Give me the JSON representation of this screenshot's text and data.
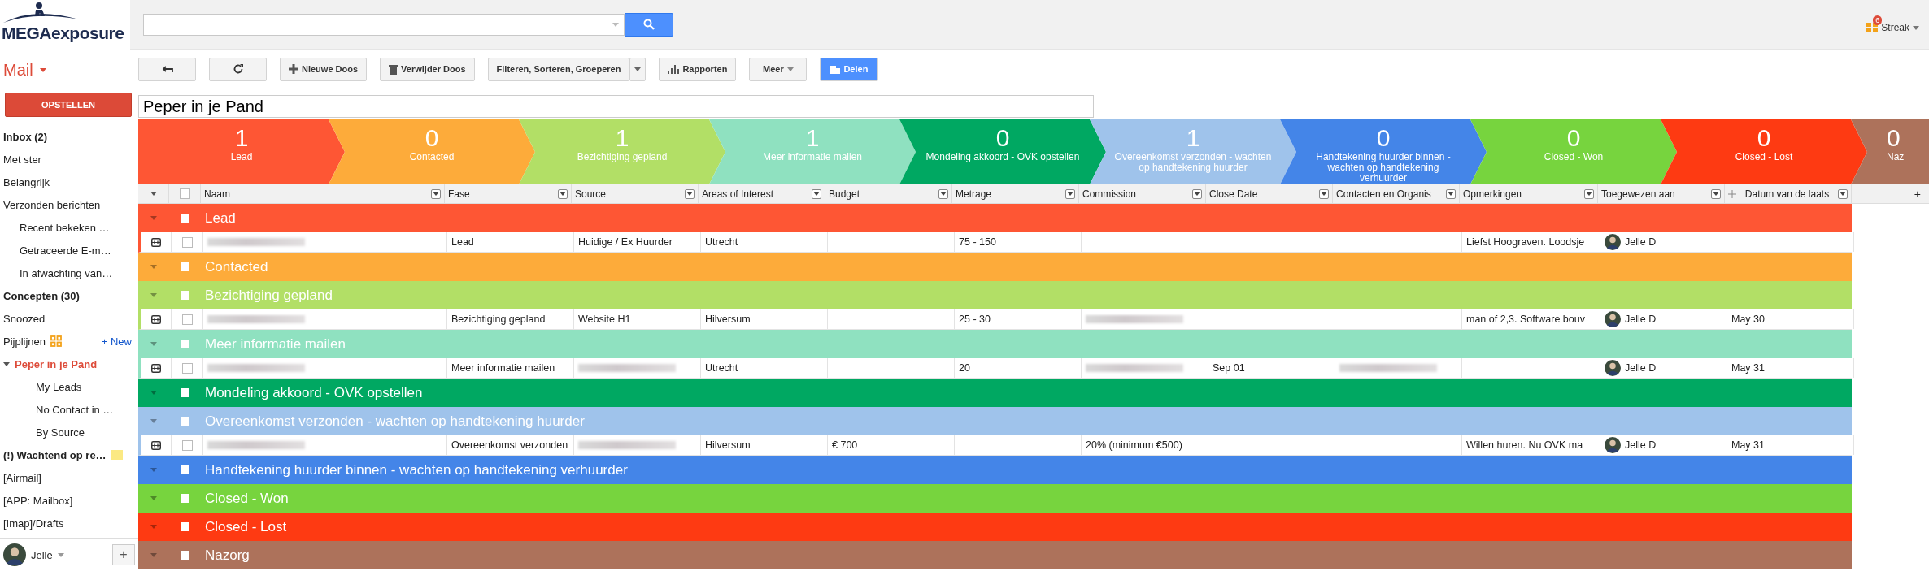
{
  "logo": {
    "text": "MEGAexposure"
  },
  "app_menu": {
    "label": "Mail"
  },
  "compose": {
    "label": "OPSTELLEN"
  },
  "nav": [
    {
      "label": "Inbox (2)",
      "bold": true,
      "selected": false
    },
    {
      "label": "Met ster",
      "bold": false,
      "selected": false
    },
    {
      "label": "Belangrijk",
      "bold": false,
      "selected": false
    },
    {
      "label": "Verzonden berichten",
      "bold": false,
      "selected": false,
      "children": [
        {
          "label": "Recent bekeken …",
          "bold": false,
          "selected": false
        },
        {
          "label": "Getraceerde E-m…",
          "bold": false,
          "selected": false
        },
        {
          "label": "In afwachting van…",
          "bold": false,
          "selected": false
        }
      ]
    },
    {
      "label": "Concepten (30)",
      "bold": true,
      "selected": false
    },
    {
      "label": "Snoozed",
      "bold": false,
      "selected": false
    },
    {
      "label": "Pijplijnen",
      "kind": "pipelines",
      "action": "+ New",
      "bold": false,
      "selected": false
    },
    {
      "label": "Peper in je Pand",
      "bold": true,
      "selected": true,
      "expanded": true,
      "children": [
        {
          "label": "My Leads",
          "bold": false,
          "selected": false
        },
        {
          "label": "No Contact in …",
          "bold": false,
          "selected": false
        },
        {
          "label": "By Source",
          "bold": false,
          "selected": false
        }
      ]
    },
    {
      "label": "(!) Wachtend op re…",
      "bold": true,
      "selected": false,
      "color": "#fbe983"
    },
    {
      "label": "[Airmail]",
      "bold": false,
      "selected": false
    },
    {
      "label": "[APP: Mailbox]",
      "bold": false,
      "selected": false
    },
    {
      "label": "[Imap]/Drafts",
      "bold": false,
      "selected": false
    }
  ],
  "account": {
    "name": "Jelle",
    "add": "+"
  },
  "streak": {
    "label": "Streak",
    "badge": "6"
  },
  "toolbar": [
    {
      "kind": "back"
    },
    {
      "kind": "refresh"
    },
    {
      "kind": "new",
      "label": "Nieuwe Doos"
    },
    {
      "kind": "delete",
      "label": "Verwijder Doos"
    },
    {
      "kind": "filter",
      "label": "Filteren, Sorteren, Groeperen"
    },
    {
      "kind": "reports",
      "label": "Rapporten"
    },
    {
      "kind": "more",
      "label": "Meer"
    },
    {
      "kind": "share",
      "label": "Delen"
    }
  ],
  "pipeline_title": {
    "value": "Peper in je Pand"
  },
  "stages": [
    {
      "count": "1",
      "label": "Lead",
      "color": "#fe5634"
    },
    {
      "count": "0",
      "label": "Contacted",
      "color": "#fdab3a"
    },
    {
      "count": "1",
      "label": "Bezichtiging gepland",
      "color": "#b2df66"
    },
    {
      "count": "1",
      "label": "Meer informatie mailen",
      "color": "#8fe1c0"
    },
    {
      "count": "0",
      "label": "Mondeling akkoord - OVK opstellen",
      "color": "#00a862"
    },
    {
      "count": "1",
      "label": "Overeenkomst verzonden - wachten op handtekening huurder",
      "color": "#9fc3eb"
    },
    {
      "count": "0",
      "label": "Handtekening huurder binnen - wachten op handtekening verhuurder",
      "color": "#4485e8"
    },
    {
      "count": "0",
      "label": "Closed - Won",
      "color": "#77d43e"
    },
    {
      "count": "0",
      "label": "Closed - Lost",
      "color": "#fe3a12"
    },
    {
      "count": "0",
      "label": "Naz",
      "color": "#ad725b"
    }
  ],
  "columns": [
    {
      "label": "Naam"
    },
    {
      "label": "Fase"
    },
    {
      "label": "Source"
    },
    {
      "label": "Areas of Interest"
    },
    {
      "label": "Budget"
    },
    {
      "label": "Metrage"
    },
    {
      "label": "Commission"
    },
    {
      "label": "Close Date"
    },
    {
      "label": "Contacten en Organis"
    },
    {
      "label": "Opmerkingen"
    },
    {
      "label": "Toegewezen aan"
    },
    {
      "label": "Datum van de laats",
      "kind": "magic"
    }
  ],
  "select_all": {
    "checked": false
  },
  "add_column": "+",
  "groups": [
    {
      "label": "Lead",
      "color": "#fe5634",
      "checked": false,
      "rows": [
        {
          "checked": false,
          "cells": [
            {
              "kind": "redacted"
            },
            {
              "kind": "text",
              "text": "Lead"
            },
            {
              "kind": "text",
              "text": "Huidige / Ex Huurder"
            },
            {
              "kind": "text",
              "text": "Utrecht"
            },
            {
              "kind": "empty"
            },
            {
              "kind": "text",
              "text": "75 - 150"
            },
            {
              "kind": "empty"
            },
            {
              "kind": "empty"
            },
            {
              "kind": "empty"
            },
            {
              "kind": "text",
              "text": "Liefst Hoograven. Loodsje"
            },
            {
              "kind": "assignee",
              "text": "Jelle D"
            },
            {
              "kind": "empty"
            }
          ]
        }
      ]
    },
    {
      "label": "Contacted",
      "color": "#fdab3a",
      "checked": false
    },
    {
      "label": "Bezichtiging gepland",
      "color": "#b2df66",
      "checked": false,
      "rows": [
        {
          "checked": false,
          "cells": [
            {
              "kind": "redacted"
            },
            {
              "kind": "text",
              "text": "Bezichtiging gepland"
            },
            {
              "kind": "text",
              "text": "Website H1"
            },
            {
              "kind": "text",
              "text": "Hilversum"
            },
            {
              "kind": "empty"
            },
            {
              "kind": "text",
              "text": "25 - 30"
            },
            {
              "kind": "redacted"
            },
            {
              "kind": "empty"
            },
            {
              "kind": "empty"
            },
            {
              "kind": "text",
              "text": "man of 2,3. Software bouv"
            },
            {
              "kind": "assignee",
              "text": "Jelle D"
            },
            {
              "kind": "text",
              "text": "May 30"
            }
          ]
        }
      ]
    },
    {
      "label": "Meer informatie mailen",
      "color": "#8fe1c0",
      "checked": false,
      "rows": [
        {
          "checked": false,
          "cells": [
            {
              "kind": "redacted"
            },
            {
              "kind": "text",
              "text": "Meer informatie mailen"
            },
            {
              "kind": "redacted"
            },
            {
              "kind": "text",
              "text": "Utrecht"
            },
            {
              "kind": "empty"
            },
            {
              "kind": "text",
              "text": "20"
            },
            {
              "kind": "redacted"
            },
            {
              "kind": "text",
              "text": "Sep 01"
            },
            {
              "kind": "redacted"
            },
            {
              "kind": "empty"
            },
            {
              "kind": "assignee",
              "text": "Jelle D"
            },
            {
              "kind": "text",
              "text": "May 31"
            }
          ]
        }
      ]
    },
    {
      "label": "Mondeling akkoord - OVK opstellen",
      "color": "#00a862",
      "checked": false
    },
    {
      "label": "Overeenkomst verzonden - wachten op handtekening huurder",
      "color": "#9fc3eb",
      "checked": false,
      "rows": [
        {
          "checked": false,
          "cells": [
            {
              "kind": "redacted"
            },
            {
              "kind": "text",
              "text": "Overeenkomst verzonden"
            },
            {
              "kind": "redacted"
            },
            {
              "kind": "text",
              "text": "Hilversum"
            },
            {
              "kind": "text",
              "text": "€ 700"
            },
            {
              "kind": "empty"
            },
            {
              "kind": "text",
              "text": "20% (minimum €500)"
            },
            {
              "kind": "empty"
            },
            {
              "kind": "empty"
            },
            {
              "kind": "text",
              "text": "Willen huren. Nu OVK ma"
            },
            {
              "kind": "assignee",
              "text": "Jelle D"
            },
            {
              "kind": "text",
              "text": "May 31"
            }
          ]
        }
      ]
    },
    {
      "label": "Handtekening huurder binnen - wachten op handtekening verhuurder",
      "color": "#4485e8",
      "checked": false
    },
    {
      "label": "Closed - Won",
      "color": "#77d43e",
      "checked": false
    },
    {
      "label": "Closed - Lost",
      "color": "#fe3a12",
      "checked": false
    },
    {
      "label": "Nazorg",
      "color": "#ad725b",
      "checked": false
    }
  ]
}
